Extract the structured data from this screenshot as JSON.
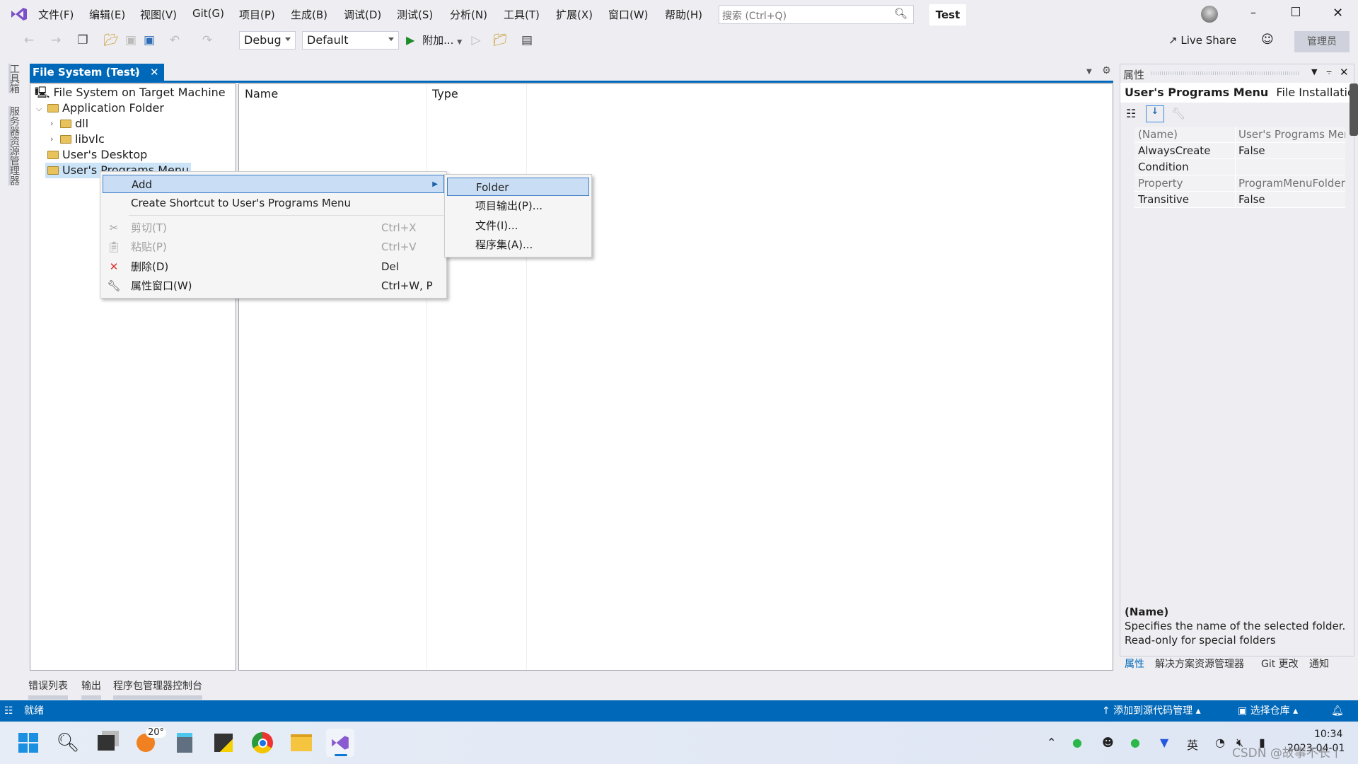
{
  "menubar": {
    "items": [
      "文件(F)",
      "编辑(E)",
      "视图(V)",
      "Git(G)",
      "项目(P)",
      "生成(B)",
      "调试(D)",
      "测试(S)",
      "分析(N)",
      "工具(T)",
      "扩展(X)",
      "窗口(W)",
      "帮助(H)"
    ],
    "search_placeholder": "搜索 (Ctrl+Q)",
    "solution_name": "Test"
  },
  "toolbar": {
    "config": "Debug",
    "platform": "Default",
    "attach_label": "附加...",
    "live_share": "Live Share",
    "admin_label": "管理员"
  },
  "left_strip": {
    "toolbox": "工具箱",
    "server_explorer": "服务器资源管理器"
  },
  "document_tab": {
    "title": "File System (Test)"
  },
  "tree": {
    "items": [
      {
        "label": "File System on Target Machine"
      },
      {
        "label": "Application Folder"
      },
      {
        "label": "dll"
      },
      {
        "label": "libvlc"
      },
      {
        "label": "User's Desktop"
      },
      {
        "label": "User's Programs Menu"
      }
    ]
  },
  "list": {
    "columns": [
      "Name",
      "Type"
    ]
  },
  "context_menu": {
    "items": [
      {
        "label": "Add",
        "shortcut": ""
      },
      {
        "label": "Create Shortcut to User's Programs Menu",
        "shortcut": ""
      },
      {
        "label": "剪切(T)",
        "shortcut": "Ctrl+X"
      },
      {
        "label": "粘贴(P)",
        "shortcut": "Ctrl+V"
      },
      {
        "label": "删除(D)",
        "shortcut": "Del"
      },
      {
        "label": "属性窗口(W)",
        "shortcut": "Ctrl+W, P"
      }
    ]
  },
  "submenu": {
    "items": [
      "Folder",
      "项目输出(P)...",
      "文件(I)...",
      "程序集(A)..."
    ]
  },
  "properties": {
    "title": "属性",
    "object_name": "User's Programs Menu",
    "object_type": "File Installation P",
    "rows": [
      {
        "name": "(Name)",
        "value": "User's Programs Menu"
      },
      {
        "name": "AlwaysCreate",
        "value": "False"
      },
      {
        "name": "Condition",
        "value": ""
      },
      {
        "name": "Property",
        "value": "ProgramMenuFolder"
      },
      {
        "name": "Transitive",
        "value": "False"
      }
    ],
    "desc_title": "(Name)",
    "desc_text": "Specifies the name of the selected folder. Read-only for special folders",
    "tabs": [
      "属性",
      "解决方案资源管理器",
      "Git 更改",
      "通知"
    ]
  },
  "bottom_tabs": [
    "错误列表",
    "输出",
    "程序包管理器控制台"
  ],
  "statusbar": {
    "status": "就绪",
    "source_control": "添加到源代码管理",
    "repo": "选择仓库"
  },
  "taskbar": {
    "weather": "20°",
    "ime": "英",
    "time": "10:34",
    "date": "2023-04-01",
    "watermark": "CSDN @故事不长丨"
  },
  "colors": {
    "accent": "#0068b8",
    "status_bar": "#0068b8",
    "highlight": "#c9def5",
    "vs_purple": "#7b4fc9"
  }
}
